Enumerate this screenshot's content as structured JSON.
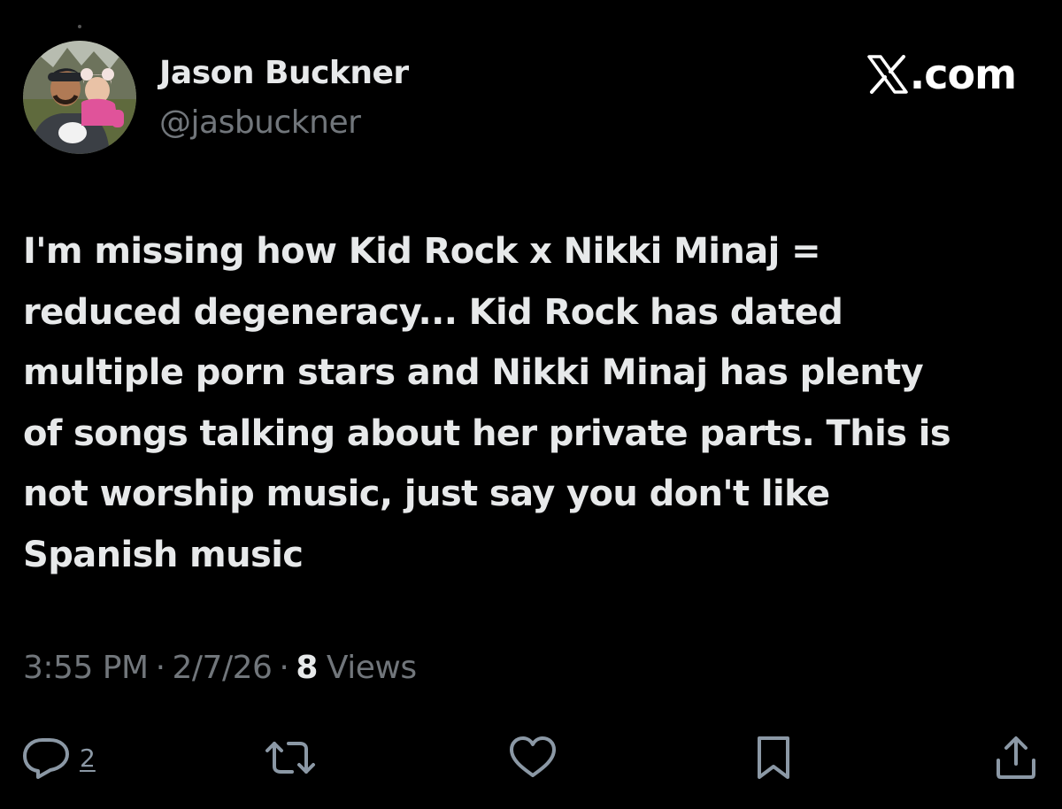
{
  "author": {
    "name": "Jason Buckner",
    "handle": "@jasbuckner",
    "avatar_icon": "avatar-photo"
  },
  "watermark": {
    "logo_icon": "x-logo-icon",
    "text": ".com"
  },
  "tweet": {
    "lines": [
      "I'm missing how Kid Rock x Nikki Minaj =",
      "reduced degeneracy... Kid Rock has dated",
      "multiple porn stars and Nikki Minaj has plenty",
      "of songs talking about her private parts. This is",
      "not worship music, just say you don't like",
      "Spanish music"
    ]
  },
  "meta": {
    "time": "3:55 PM",
    "separator": "·",
    "date": "2/7/26",
    "views_count": "8",
    "views_label": "Views"
  },
  "actions": {
    "reply": {
      "icon": "reply-icon",
      "count": "2"
    },
    "repost": {
      "icon": "repost-icon"
    },
    "like": {
      "icon": "heart-icon"
    },
    "bookmark": {
      "icon": "bookmark-icon"
    },
    "share": {
      "icon": "share-icon"
    }
  },
  "colors": {
    "background": "#000000",
    "primary_text": "#e7e9ea",
    "secondary_text": "#71767b",
    "icon": "#8b98a5"
  }
}
